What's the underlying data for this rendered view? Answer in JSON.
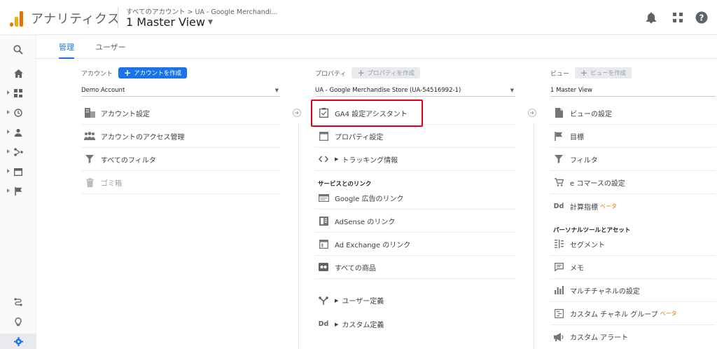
{
  "header": {
    "app_title": "アナリティクス",
    "breadcrumb": "すべてのアカウント > UA - Google Merchandi...",
    "view_name": "1 Master View"
  },
  "tabs": [
    {
      "label": "管理",
      "active": true
    },
    {
      "label": "ユーザー",
      "active": false
    }
  ],
  "account": {
    "header_label": "アカウント",
    "create_label": "アカウントを作成",
    "selected": "Demo Account",
    "items": [
      {
        "label": "アカウント設定",
        "icon": "building-icon"
      },
      {
        "label": "アカウントのアクセス管理",
        "icon": "people-icon"
      },
      {
        "label": "すべてのフィルタ",
        "icon": "filter-icon"
      },
      {
        "label": "ゴミ箱",
        "icon": "trash-icon"
      }
    ]
  },
  "property": {
    "header_label": "プロパティ",
    "create_label": "プロパティを作成",
    "selected": "UA - Google Merchandise Store (UA-54516992-1)",
    "items": [
      {
        "label": "GA4 設定アシスタント",
        "icon": "checklist-icon"
      },
      {
        "label": "プロパティ設定",
        "icon": "property-icon"
      },
      {
        "label": "トラッキング情報",
        "icon": "code-icon"
      }
    ],
    "section_links": "サービスとのリンク",
    "link_items": [
      {
        "label": "Google 広告のリンク",
        "icon": "ads-icon"
      },
      {
        "label": "AdSense のリンク",
        "icon": "adsense-icon"
      },
      {
        "label": "Ad Exchange のリンク",
        "icon": "adexchange-icon"
      },
      {
        "label": "すべての商品",
        "icon": "products-icon"
      }
    ],
    "extra_items": [
      {
        "label": "ユーザー定義",
        "icon": "user-definition-icon"
      },
      {
        "label": "カスタム定義",
        "icon": "dd-icon"
      }
    ]
  },
  "view": {
    "header_label": "ビュー",
    "create_label": "ビューを作成",
    "selected": "1 Master View",
    "items": [
      {
        "label": "ビューの設定",
        "icon": "document-icon"
      },
      {
        "label": "目標",
        "icon": "flag-icon"
      },
      {
        "label": "フィルタ",
        "icon": "filter-icon"
      },
      {
        "label": "e コマースの設定",
        "icon": "cart-icon"
      },
      {
        "label": "計算指標",
        "icon": "dd-icon",
        "beta": "ベータ"
      }
    ],
    "section_personal": "パーソナルツールとアセット",
    "personal_items": [
      {
        "label": "セグメント",
        "icon": "segment-icon"
      },
      {
        "label": "メモ",
        "icon": "comment-icon"
      },
      {
        "label": "マルチチャネルの設定",
        "icon": "bar-chart-icon"
      },
      {
        "label": "カスタム チャネル グループ",
        "icon": "channel-group-icon",
        "beta": "ベータ"
      },
      {
        "label": "カスタム アラート",
        "icon": "megaphone-icon"
      }
    ]
  },
  "colors": {
    "accent": "#1a73e8",
    "brand_orange": "#e37400",
    "highlight": "#e60012"
  }
}
